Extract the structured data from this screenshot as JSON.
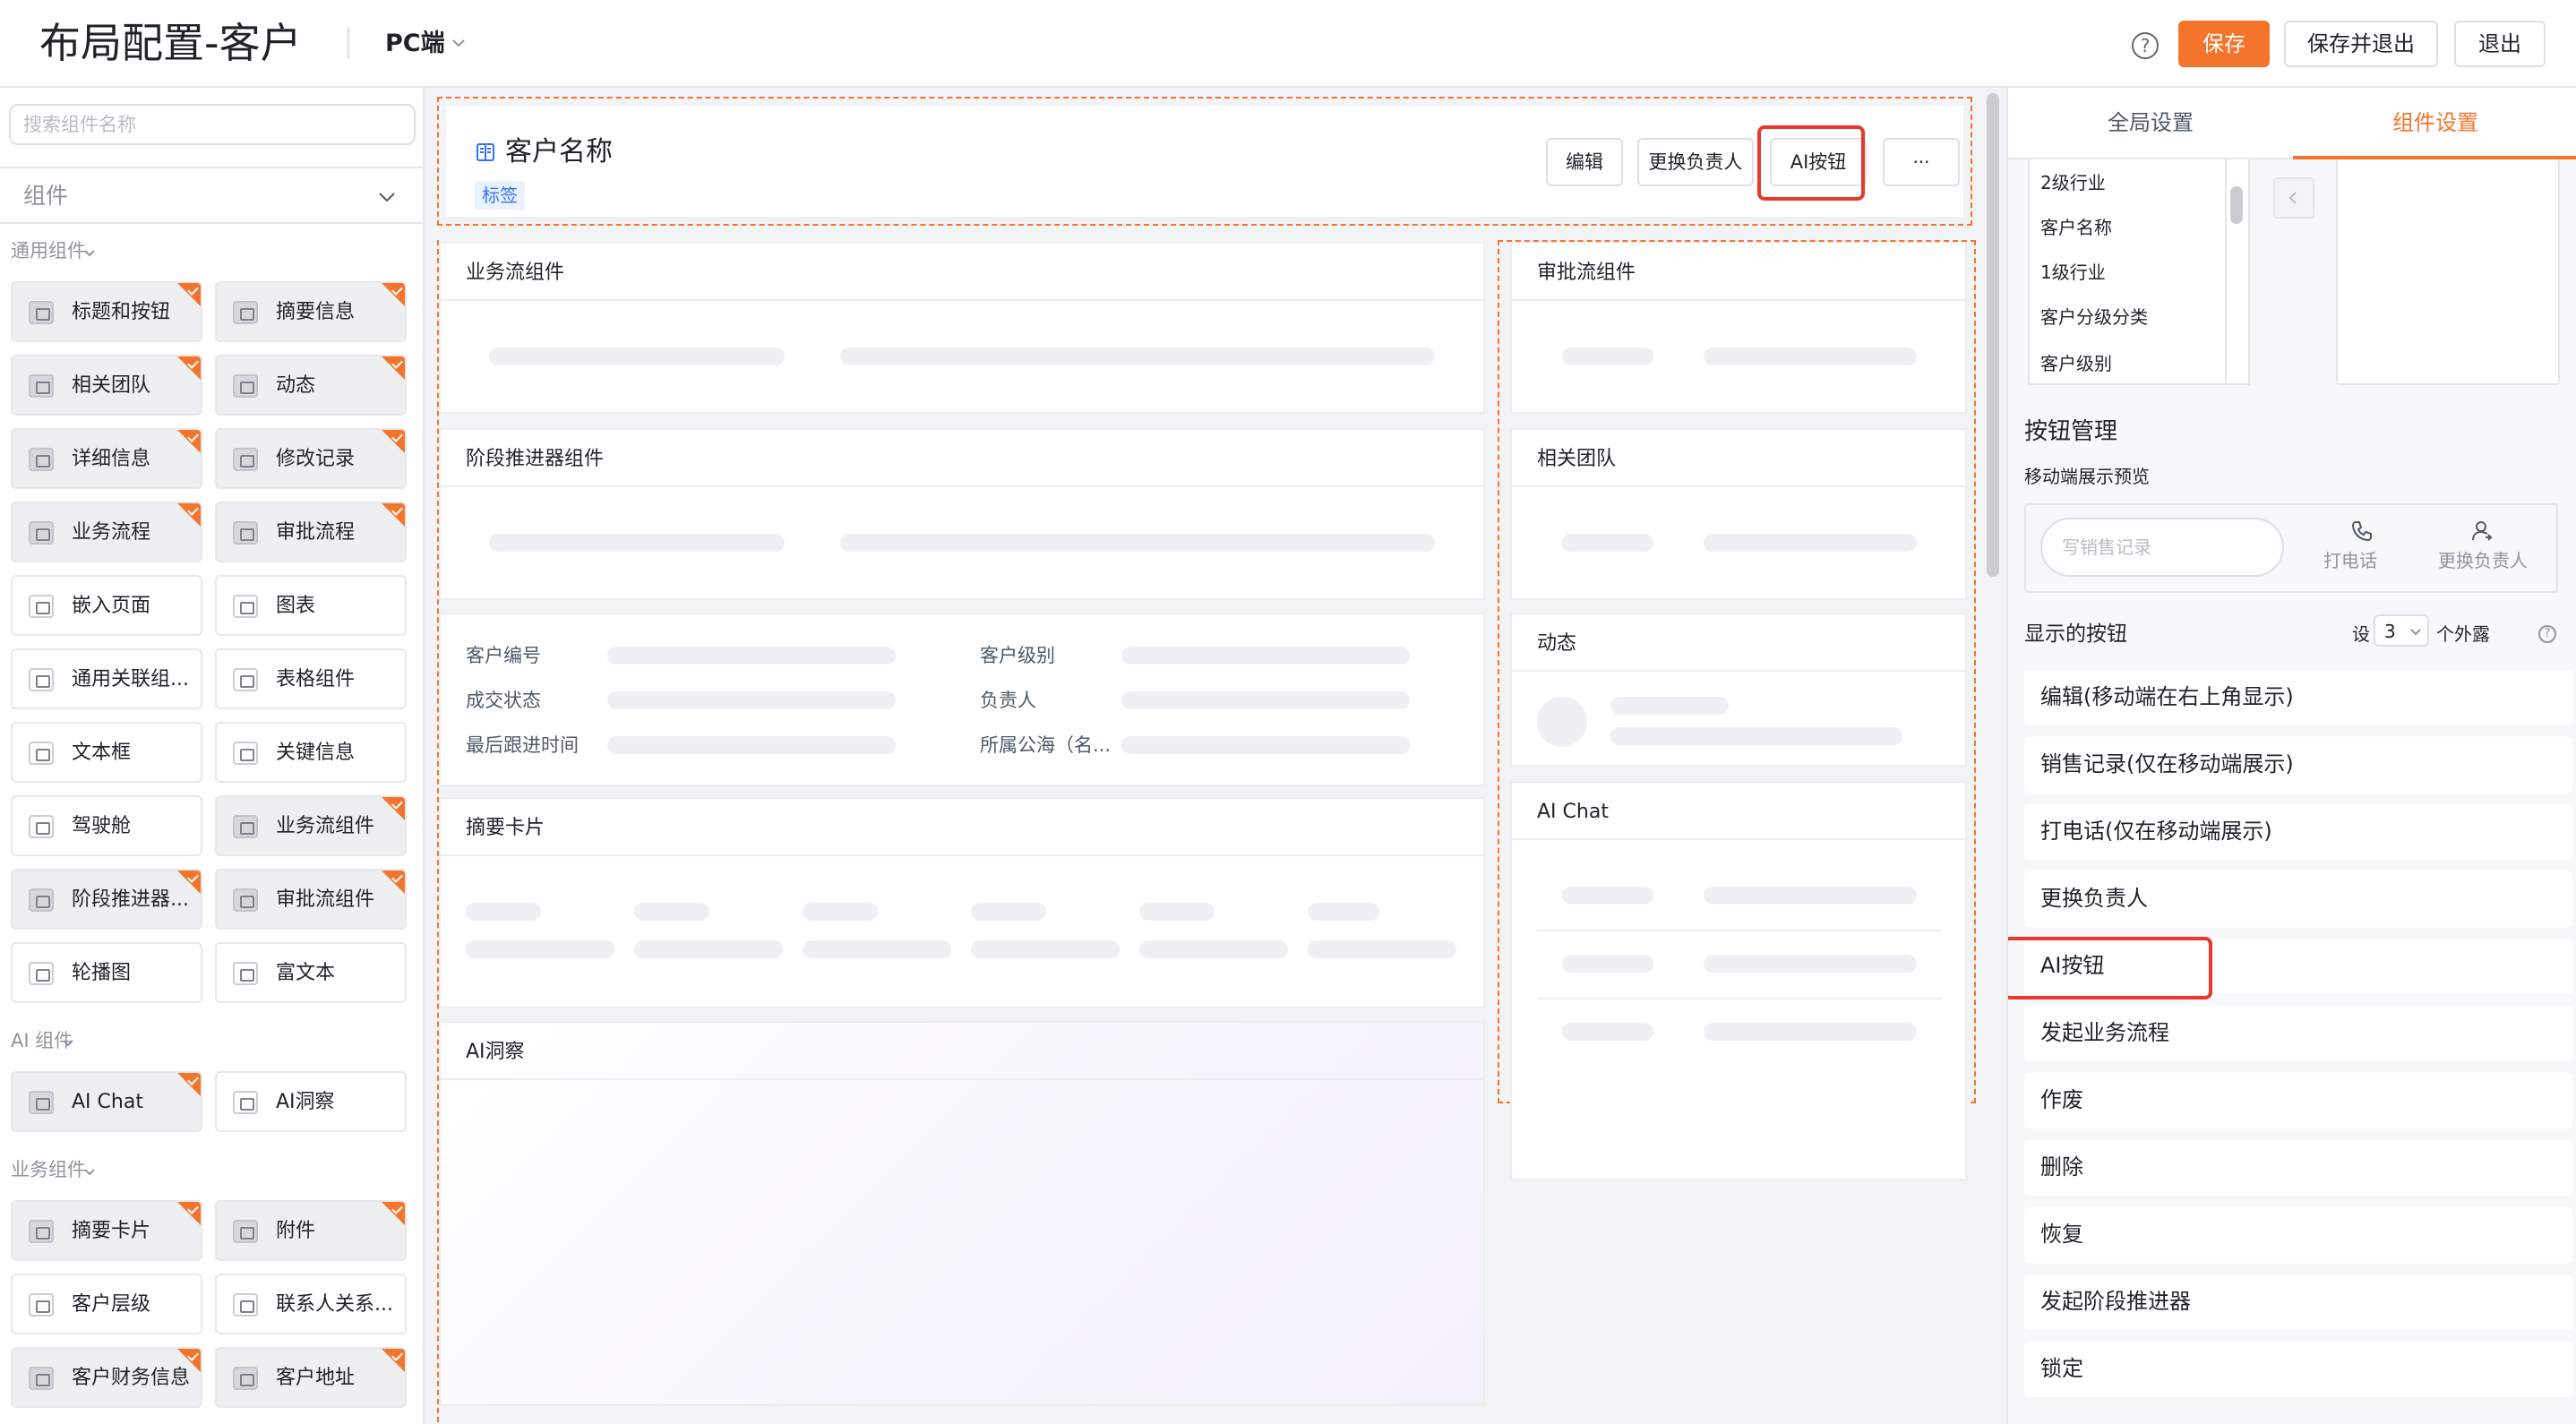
{
  "header": {
    "title": "布局配置-客户",
    "platform": "PC端",
    "help_icon": "?",
    "save": "保存",
    "save_exit": "保存并退出",
    "exit": "退出"
  },
  "left": {
    "search_placeholder": "搜索组件名称",
    "select_label": "组件",
    "groups": [
      {
        "label": "通用组件",
        "items": [
          {
            "label": "标题和按钮",
            "used": true
          },
          {
            "label": "摘要信息",
            "used": true
          },
          {
            "label": "相关团队",
            "used": true
          },
          {
            "label": "动态",
            "used": true
          },
          {
            "label": "详细信息",
            "used": true
          },
          {
            "label": "修改记录",
            "used": true
          },
          {
            "label": "业务流程",
            "used": true
          },
          {
            "label": "审批流程",
            "used": true
          },
          {
            "label": "嵌入页面",
            "used": false
          },
          {
            "label": "图表",
            "used": false
          },
          {
            "label": "通用关联组...",
            "used": false
          },
          {
            "label": "表格组件",
            "used": false
          },
          {
            "label": "文本框",
            "used": false
          },
          {
            "label": "关键信息",
            "used": false
          },
          {
            "label": "驾驶舱",
            "used": false
          },
          {
            "label": "业务流组件",
            "used": true
          },
          {
            "label": "阶段推进器...",
            "used": true
          },
          {
            "label": "审批流组件",
            "used": true
          },
          {
            "label": "轮播图",
            "used": false
          },
          {
            "label": "富文本",
            "used": false
          }
        ]
      },
      {
        "label": "AI 组件",
        "items": [
          {
            "label": "AI Chat",
            "used": true
          },
          {
            "label": "AI洞察",
            "used": false
          }
        ]
      },
      {
        "label": "业务组件",
        "items": [
          {
            "label": "摘要卡片",
            "used": true
          },
          {
            "label": "附件",
            "used": true
          },
          {
            "label": "客户层级",
            "used": false
          },
          {
            "label": "联系人关系...",
            "used": false
          },
          {
            "label": "客户财务信息",
            "used": true
          },
          {
            "label": "客户地址",
            "used": true
          }
        ]
      }
    ]
  },
  "canvas": {
    "header_card": {
      "title": "客户名称",
      "tag": "标签",
      "buttons": [
        "编辑",
        "更换负责人",
        "AI按钮",
        "···"
      ]
    },
    "left_cards": {
      "biz_flow": "业务流组件",
      "stage": "阶段推进器组件",
      "detail_fields": [
        "客户编号",
        "客户级别",
        "成交状态",
        "负责人",
        "最后跟进时间",
        "所属公海（名..."
      ],
      "summary": "摘要卡片",
      "ai_insight": "AI洞察"
    },
    "right_cards": {
      "approval": "审批流组件",
      "team": "相关团队",
      "dynamic": "动态",
      "ai_chat": "AI Chat"
    }
  },
  "right": {
    "tabs": [
      "全局设置",
      "组件设置"
    ],
    "active_tab": "组件设置",
    "field_list": [
      "2级行业",
      "客户名称",
      "1级行业",
      "客户分级分类",
      "客户级别"
    ],
    "btn_mgmt_title": "按钮管理",
    "mobile_preview_label": "移动端展示预览",
    "preview_input": "写销售记录",
    "preview_call": "打电话",
    "preview_change_owner": "更换负责人",
    "shown_label": "显示的按钮",
    "set_label": "设",
    "expose_count": "3",
    "expose_suffix": "个外露",
    "buttons": [
      "编辑(移动端在右上角显示)",
      "销售记录(仅在移动端展示)",
      "打电话(仅在移动端展示)",
      "更换负责人",
      "AI按钮",
      "发起业务流程",
      "作废",
      "删除",
      "恢复",
      "发起阶段推进器",
      "锁定"
    ]
  },
  "colors": {
    "accent": "#f5742b",
    "highlight": "#e8392b",
    "tag_bg": "#e8f3ff",
    "tag_text": "#3370ff"
  }
}
